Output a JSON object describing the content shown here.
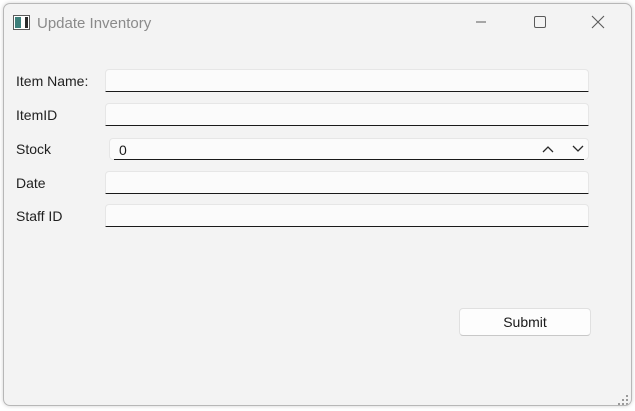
{
  "window": {
    "title": "Update Inventory"
  },
  "titlebar": {
    "icons": [
      "app-icon",
      "minimize-icon",
      "maximize-icon",
      "close-icon"
    ]
  },
  "form": {
    "item_name": {
      "label": "Item Name:",
      "value": ""
    },
    "item_id": {
      "label": "ItemID",
      "value": ""
    },
    "stock": {
      "label": "Stock",
      "value": "0"
    },
    "date": {
      "label": "Date",
      "value": ""
    },
    "staff_id": {
      "label": "Staff ID",
      "value": ""
    }
  },
  "actions": {
    "submit_label": "Submit"
  },
  "colors": {
    "window_bg": "#f3f3f3",
    "field_bg": "#fbfbfb",
    "underline": "#1a1a1a",
    "title_text": "#8a8a8a"
  }
}
